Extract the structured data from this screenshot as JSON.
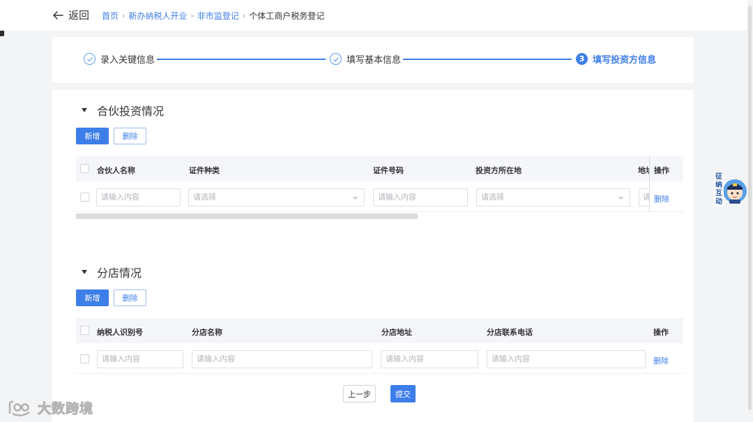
{
  "header": {
    "back_label": "返回",
    "breadcrumb": [
      "首页",
      "新办纳税人开业",
      "非市监登记"
    ],
    "breadcrumb_current": "个体工商户税务登记",
    "separator": "›"
  },
  "stepper": {
    "steps": [
      {
        "label": "录入关键信息",
        "state": "done"
      },
      {
        "label": "填写基本信息",
        "state": "done"
      },
      {
        "label": "填写投资方信息",
        "state": "active",
        "number": "3"
      }
    ]
  },
  "partner": {
    "title": "合伙投资情况",
    "add_label": "新增",
    "delete_label": "删除",
    "columns": [
      "合伙人名称",
      "证件种类",
      "证件号码",
      "投资方所在地",
      "地址",
      "操作"
    ],
    "row": {
      "name_placeholder": "请输入内容",
      "id_type_placeholder": "请选择",
      "id_number_placeholder": "请输入内容",
      "location_placeholder": "请选择",
      "address_placeholder": "请输入内容",
      "action": "删除"
    }
  },
  "branch": {
    "title": "分店情况",
    "add_label": "新增",
    "delete_label": "删除",
    "columns": [
      "纳税人识别号",
      "分店名称",
      "分店地址",
      "分店联系电话",
      "操作"
    ],
    "row": {
      "tax_id_placeholder": "请输入内容",
      "name_placeholder": "请输入内容",
      "address_placeholder": "请输入内容",
      "phone_placeholder": "请输入内容",
      "action": "删除"
    }
  },
  "footer": {
    "prev_label": "上一步",
    "submit_label": "提交"
  },
  "mascot": {
    "text": "征纳互动"
  },
  "watermark": {
    "text": "大数跨境"
  },
  "colors": {
    "primary": "#3d7ee8",
    "background": "#f3f4f6"
  }
}
